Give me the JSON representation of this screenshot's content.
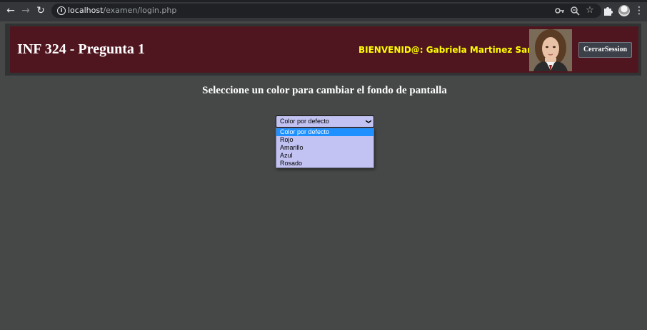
{
  "browser": {
    "url_host": "localhost",
    "url_path": "/examen/login.php"
  },
  "header": {
    "title": "INF 324 - Pregunta 1",
    "welcome": "BIENVENID@: Gabriela Martinez Sanchez",
    "logout_label": "CerrarSession"
  },
  "main": {
    "heading": "Seleccione un color para cambiar el fondo de pantalla",
    "select_value": "Color por defecto",
    "options": [
      "Color por defecto",
      "Rojo",
      "Amarillo",
      "Azul",
      "Rosado"
    ],
    "selected_option": "Color por defecto"
  },
  "colors": {
    "page_background": "#464847",
    "header_background": "#50161f",
    "welcome_text": "#ffff00",
    "select_background": "#c2c3f2",
    "option_highlight": "#1e90ff"
  },
  "icons": [
    "back-icon",
    "forward-icon",
    "reload-icon",
    "info-icon",
    "key-icon",
    "zoom-icon",
    "star-icon",
    "extensions-icon",
    "profile-icon",
    "menu-icon"
  ]
}
